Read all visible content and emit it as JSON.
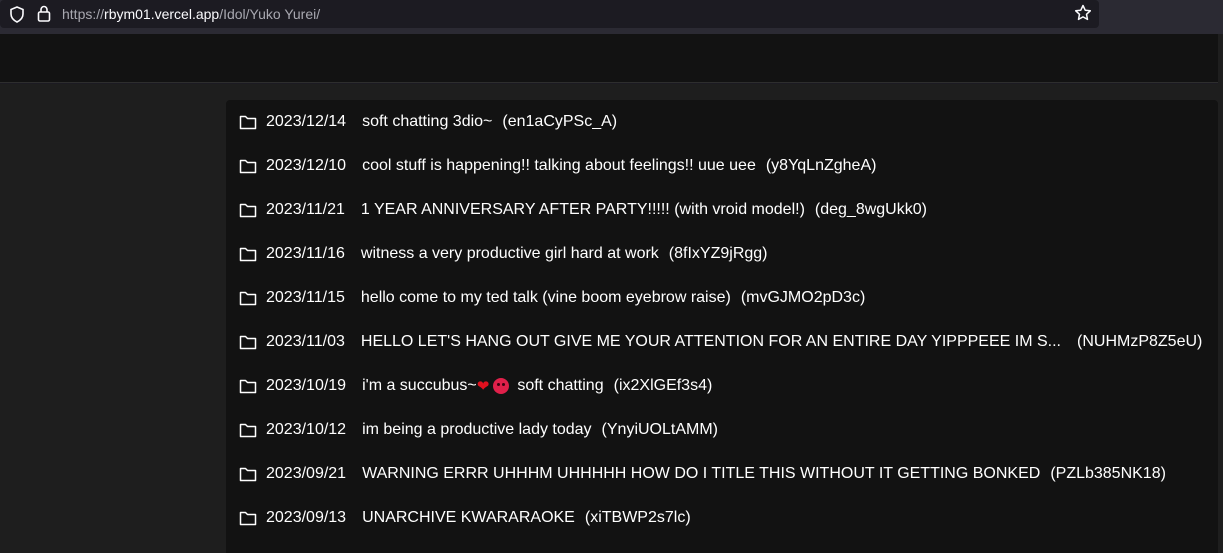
{
  "browser": {
    "url_prefix": "https://",
    "url_host": "rbym01.vercel.app",
    "url_path": "/Idol/Yuko Yurei/"
  },
  "videos": [
    {
      "date": "2023/12/14",
      "title": "soft chatting 3dio~",
      "id": "(en1aCyPSc_A)"
    },
    {
      "date": "2023/12/10",
      "title": "cool stuff is happening!! talking about feelings!! uue uee",
      "id": "(y8YqLnZgheA)"
    },
    {
      "date": "2023/11/21",
      "title": "1 YEAR ANNIVERSARY AFTER PARTY!!!!! (with vroid model!)",
      "id": "(deg_8wgUkk0)"
    },
    {
      "date": "2023/11/16",
      "title": "witness a very productive girl hard at work",
      "id": "(8fIxYZ9jRgg)"
    },
    {
      "date": "2023/11/15",
      "title": "hello come to my ted talk (vine boom eyebrow raise)",
      "id": "(mvGJMO2pD3c)"
    },
    {
      "date": "2023/11/03",
      "title": "HELLO LET'S HANG OUT GIVE ME YOUR ATTENTION FOR AN ENTIRE DAY YIPPPEEE IM S...",
      "id": "(NUHMzP8Z5eU)"
    },
    {
      "date": "2023/10/19",
      "title_before": "i'm a succubus~",
      "title_after": "soft chatting",
      "id": "(ix2XlGEf3s4)"
    },
    {
      "date": "2023/10/12",
      "title": "im being a productive lady today",
      "id": "(YnyiUOLtAMM)"
    },
    {
      "date": "2023/09/21",
      "title": "WARNING ERRR UHHHM UHHHHH HOW DO I TITLE THIS WITHOUT IT GETTING BONKED",
      "id": "(PZLb385NK18)"
    },
    {
      "date": "2023/09/13",
      "title": "UNARCHIVE KWARARAOKE",
      "id": "(xiTBWP2s7lc)"
    }
  ]
}
